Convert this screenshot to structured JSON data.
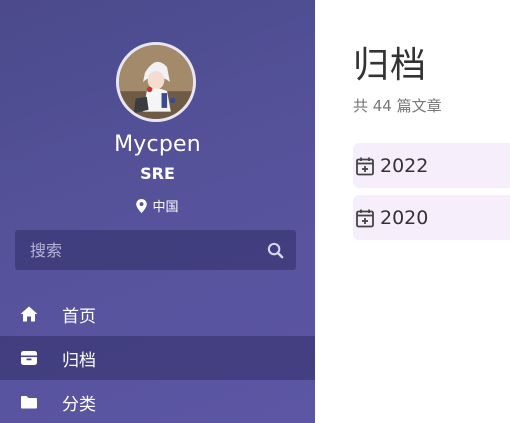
{
  "sidebar": {
    "author_name": "Mycpen",
    "author_role": "SRE",
    "location": "中国",
    "search_placeholder": "搜索",
    "nav": [
      {
        "label": "首页",
        "icon": "home-icon"
      },
      {
        "label": "归档",
        "icon": "archive-icon",
        "active": true
      },
      {
        "label": "分类",
        "icon": "folder-icon"
      }
    ]
  },
  "main": {
    "title": "归档",
    "subtitle": "共 44 篇文章",
    "archives": [
      {
        "year": "2022",
        "icon": "calendar-plus-icon"
      },
      {
        "year": "2020",
        "icon": "calendar-plus-icon"
      }
    ]
  },
  "colors": {
    "sidebar_bg": "#55529a",
    "active_bg": "#3f3d80",
    "archive_item_bg": "#f6effb"
  }
}
